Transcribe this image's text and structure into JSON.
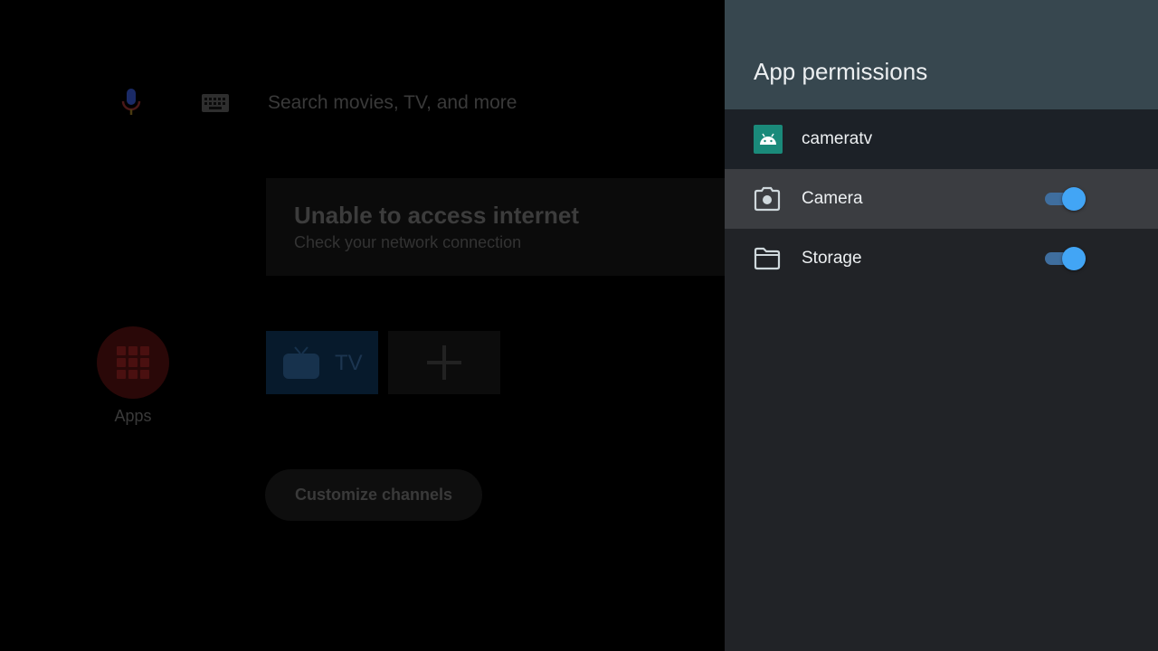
{
  "launcher": {
    "search_placeholder": "Search movies, TV, and more",
    "mic_icon": "microphone-icon",
    "keyboard_icon": "keyboard-icon",
    "notice": {
      "title": "Unable to access internet",
      "subtitle": "Check your network connection"
    },
    "apps_label": "Apps",
    "tiles": [
      {
        "label": "TV",
        "icon": "tv-icon"
      },
      {
        "label": "",
        "icon": "plus-icon"
      }
    ],
    "customize_label": "Customize channels"
  },
  "panel": {
    "title": "App permissions",
    "app": {
      "name": "cameratv",
      "icon": "android-icon"
    },
    "permissions": [
      {
        "label": "Camera",
        "icon": "camera-icon",
        "enabled": true,
        "focused": true
      },
      {
        "label": "Storage",
        "icon": "folder-icon",
        "enabled": true,
        "focused": false
      }
    ]
  },
  "colors": {
    "panel_header": "#37474f",
    "panel_body": "#212327",
    "focused_row": "#3b3d41",
    "toggle_on": "#42a5f5",
    "app_icon": "#1a8a7a"
  }
}
